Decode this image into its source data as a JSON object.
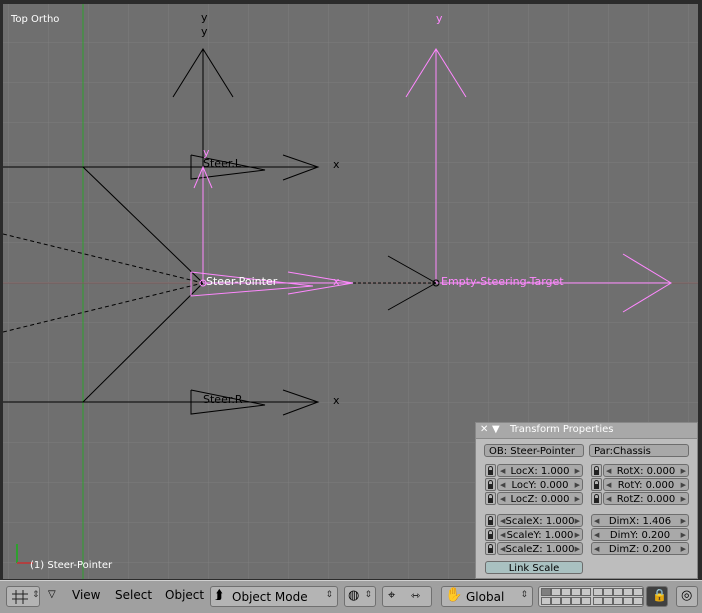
{
  "viewport": {
    "view_name": "Top Ortho",
    "active_object_label": "(1) Steer-Pointer",
    "axis_label": "y",
    "x_label": "x",
    "objects": {
      "steer_l": "Steer.L",
      "steer_pointer": "Steer-Pointer",
      "steer_r": "Steer.R",
      "target": "Empty-Steering-Target"
    },
    "colors": {
      "background": "#6f6f6f",
      "grid": "#7c7c7c",
      "selected": "#ff88ff",
      "y_axis_line": "#2ea02e",
      "x_axis_line": "#b04040"
    }
  },
  "transform_panel": {
    "title": "Transform Properties",
    "ob_field": "OB: Steer-Pointer",
    "parent_field": "Par:Chassis",
    "loc": [
      "LocX: 1.000",
      "LocY: 0.000",
      "LocZ: 0.000"
    ],
    "rot": [
      "RotX: 0.000",
      "RotY: 0.000",
      "RotZ: 0.000"
    ],
    "scale": [
      "ScaleX: 1.000",
      "ScaleY: 1.000",
      "ScaleZ: 1.000"
    ],
    "dim": [
      "DimX: 1.406",
      "DimY: 0.200",
      "DimZ: 0.200"
    ],
    "link_scale": "Link Scale"
  },
  "header": {
    "menus": [
      "View",
      "Select",
      "Object"
    ],
    "mode": "Object Mode",
    "orientation": "Global"
  }
}
